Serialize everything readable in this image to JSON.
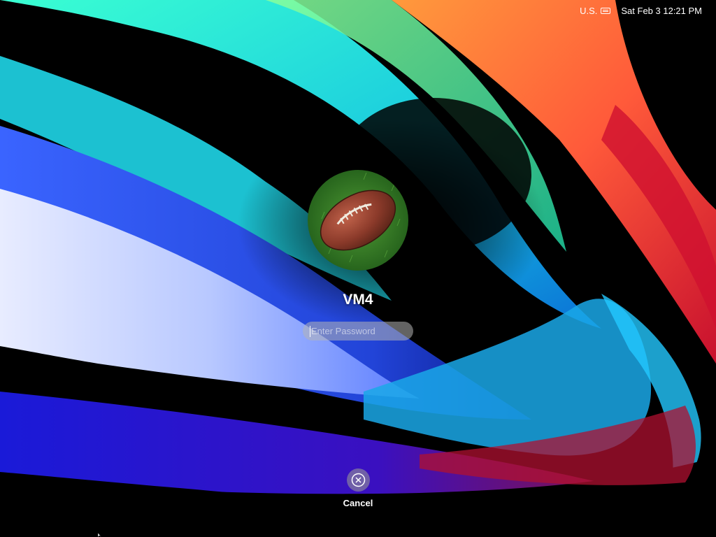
{
  "menubar": {
    "input_source": "U.S.",
    "input_source_icon": "keyboard-icon",
    "datetime": "Sat Feb 3  12:21 PM"
  },
  "login": {
    "user_name": "VM4",
    "avatar_icon": "football-avatar",
    "password_value": "",
    "password_placeholder": "Enter Password"
  },
  "actions": {
    "cancel_label": "Cancel",
    "cancel_icon": "close-circle-icon"
  },
  "colors": {
    "background": "#000000",
    "text": "#ffffff",
    "field_background": "#b4b4b4",
    "avatar_grass": "#3a7a2a",
    "football": "#8b3a2a"
  }
}
